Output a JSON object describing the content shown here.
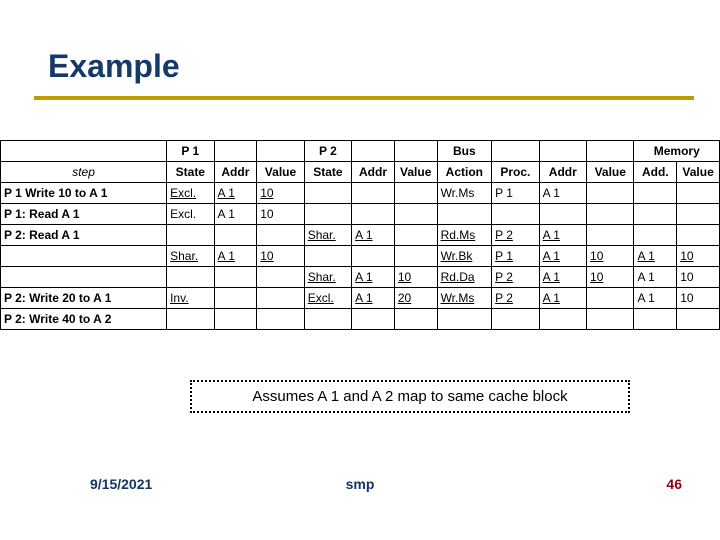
{
  "title": "Example",
  "assume": "Assumes A 1 and A 2 map to same cache block",
  "footer": {
    "date": "9/15/2021",
    "center": "smp",
    "page": "46"
  },
  "hdr": {
    "p1": "P 1",
    "p2": "P 2",
    "bus": "Bus",
    "mem": "Memory"
  },
  "sub": {
    "step": "step",
    "state": "State",
    "addr": "Addr",
    "value": "Value",
    "action": "Action",
    "proc": "Proc.",
    "maddr": "Add.",
    "mvalue": "Value"
  },
  "rows": [
    {
      "step": "P 1 Write 10 to A 1",
      "p1_state": "Excl.",
      "p1_addr": "A 1",
      "p1_value": "10",
      "p2_state": "",
      "p2_addr": "",
      "p2_value": "",
      "bus_action": "Wr.Ms",
      "bus_proc": "P 1",
      "bus_addr": "A 1",
      "bus_value": "",
      "m_addr": "",
      "m_value": "",
      "step_bold": true,
      "p1_ul": true
    },
    {
      "step": "P 1: Read A 1",
      "p1_state": "Excl.",
      "p1_addr": "A 1",
      "p1_value": "10",
      "p2_state": "",
      "p2_addr": "",
      "p2_value": "",
      "bus_action": "",
      "bus_proc": "",
      "bus_addr": "",
      "bus_value": "",
      "m_addr": "",
      "m_value": "",
      "step_bold": true
    },
    {
      "step": "P 2: Read A 1",
      "p1_state": "",
      "p1_addr": "",
      "p1_value": "",
      "p2_state": "Shar.",
      "p2_addr": "A 1",
      "p2_value": "",
      "bus_action": "Rd.Ms",
      "bus_proc": "P 2",
      "bus_addr": "A 1",
      "bus_value": "",
      "m_addr": "",
      "m_value": "",
      "step_bold": true,
      "p2_ul": true,
      "bus_ul": true
    },
    {
      "step": "",
      "p1_state": "Shar.",
      "p1_addr": "A 1",
      "p1_value": "10",
      "p2_state": "",
      "p2_addr": "",
      "p2_value": "",
      "bus_action": "Wr.Bk",
      "bus_proc": "P 1",
      "bus_addr": "A 1",
      "bus_value": "10",
      "m_addr": "A 1",
      "m_value": "10",
      "p1_ul": true,
      "bus_ul": true,
      "m_ul": true
    },
    {
      "step": "",
      "p1_state": "",
      "p1_addr": "",
      "p1_value": "",
      "p2_state": "Shar.",
      "p2_addr": "A 1",
      "p2_value": "10",
      "bus_action": "Rd.Da",
      "bus_proc": "P 2",
      "bus_addr": "A 1",
      "bus_value": "10",
      "m_addr": "A 1",
      "m_value": "10",
      "p2_ul": true,
      "bus_ul": true
    },
    {
      "step": "P 2: Write 20 to A 1",
      "p1_state": "Inv.",
      "p1_addr": "",
      "p1_value": "",
      "p2_state": "Excl.",
      "p2_addr": "A 1",
      "p2_value": "20",
      "bus_action": "Wr.Ms",
      "bus_proc": "P 2",
      "bus_addr": "A 1",
      "bus_value": "",
      "m_addr": "A 1",
      "m_value": "10",
      "step_bold": true,
      "p1_ul": true,
      "p2_ul": true,
      "bus_ul": true
    },
    {
      "step": "P 2: Write 40 to A 2",
      "p1_state": "",
      "p1_addr": "",
      "p1_value": "",
      "p2_state": "",
      "p2_addr": "",
      "p2_value": "",
      "bus_action": "",
      "bus_proc": "",
      "bus_addr": "",
      "bus_value": "",
      "m_addr": "",
      "m_value": "",
      "step_bold": true
    }
  ]
}
